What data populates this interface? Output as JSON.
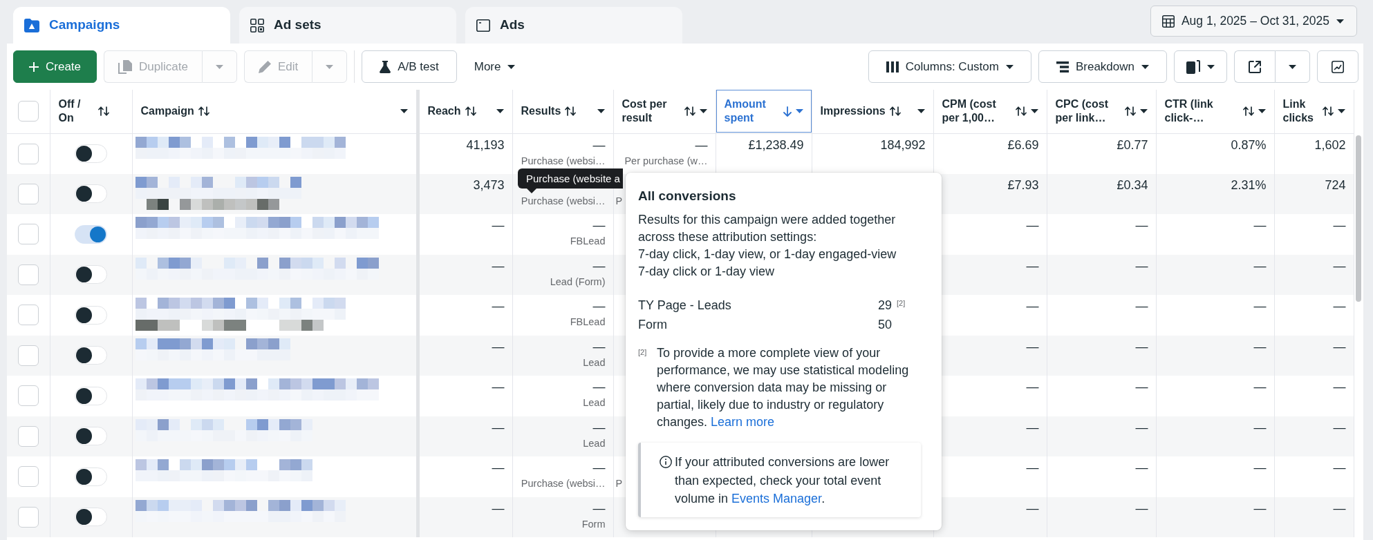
{
  "tabs": [
    {
      "kind": "campaigns",
      "label": "Campaigns",
      "selected": true
    },
    {
      "kind": "adsets",
      "label": "Ad sets",
      "selected": false
    },
    {
      "kind": "ads",
      "label": "Ads",
      "selected": false
    }
  ],
  "date_range": {
    "label": "Aug 1, 2025 – Oct 31, 2025"
  },
  "toolbar": {
    "left": [
      {
        "kind": "create",
        "label": "Create",
        "disabled": false,
        "menu": false
      },
      {
        "kind": "duplicate",
        "label": "Duplicate",
        "disabled": true,
        "menu": true,
        "split": true
      },
      {
        "kind": "edit",
        "label": "Edit",
        "disabled": true,
        "menu": true,
        "split": true
      },
      {
        "kind": "separator"
      },
      {
        "kind": "ab_test",
        "label": "A/B test",
        "disabled": false,
        "menu": false
      },
      {
        "kind": "more",
        "label": "More",
        "disabled": false,
        "menu": true,
        "split": false
      }
    ],
    "right": [
      {
        "kind": "columns",
        "label": "Columns: Custom",
        "disabled": false,
        "menu": true,
        "split": false
      },
      {
        "kind": "breakdown",
        "label": "Breakdown",
        "disabled": false,
        "menu": true,
        "split": false
      },
      {
        "kind": "reports",
        "disabled": false,
        "menu": true,
        "split": false
      },
      {
        "kind": "export",
        "disabled": false,
        "menu": true,
        "split": true
      },
      {
        "kind": "chart",
        "disabled": false,
        "menu": false
      }
    ]
  },
  "table": {
    "columns": [
      {
        "kind": "checkbox",
        "checked": false
      },
      {
        "kind": "toggle",
        "label": "Off / On",
        "sorted": false,
        "menu": false
      },
      {
        "kind": "name",
        "label": "Campaign",
        "sorted": false,
        "menu": true
      },
      {
        "kind": "metric",
        "label": "Reach",
        "sorted": false,
        "menu": true
      },
      {
        "kind": "metric",
        "label": "Results",
        "sorted": false,
        "menu": true
      },
      {
        "kind": "metric",
        "label": "Cost per result",
        "sorted": false,
        "menu": true
      },
      {
        "kind": "metric",
        "label": "Amount spent",
        "sorted": true,
        "menu": true
      },
      {
        "kind": "metric",
        "label": "Impressions",
        "sorted": false,
        "menu": true
      },
      {
        "kind": "metric",
        "label": "CPM (cost per 1,00…",
        "sorted": false,
        "menu": true
      },
      {
        "kind": "metric",
        "label": "CPC (cost per link…",
        "sorted": false,
        "menu": true
      },
      {
        "kind": "metric",
        "label": "CTR (link click-…",
        "sorted": false,
        "menu": true
      },
      {
        "kind": "metric",
        "label": "Link clicks",
        "sorted": false,
        "menu": true
      }
    ],
    "rows": [
      {
        "cells": [
          {
            "checked": false
          },
          {
            "on": false
          },
          {
            "second_line": false
          },
          {
            "value": "41,193"
          },
          {
            "value": "—",
            "note": "Purchase (websi…"
          },
          {
            "value": "—",
            "note": "Per purchase (w…",
            "covered": false
          },
          {
            "value": "£1,238.49"
          },
          {
            "value": "184,992"
          },
          {
            "value": "£6.69"
          },
          {
            "value": "£0.77"
          },
          {
            "value": "0.87%"
          },
          {
            "value": "1,602"
          }
        ]
      },
      {
        "cells": [
          {
            "checked": false
          },
          {
            "on": false
          },
          {
            "second_line": true
          },
          {
            "value": "3,473"
          },
          {
            "note": "Purchase (websi…"
          },
          {
            "note": "P",
            "covered": true
          },
          "",
          "",
          {
            "value": "£7.93"
          },
          {
            "value": "£0.34"
          },
          {
            "value": "2.31%"
          },
          {
            "value": "724"
          }
        ]
      },
      {
        "cells": [
          {
            "checked": false
          },
          {
            "on": true
          },
          {
            "second_line": false
          },
          {
            "value": "—"
          },
          {
            "value": "—",
            "note": "FBLead"
          },
          "",
          "",
          "",
          {
            "value": "—"
          },
          {
            "value": "—"
          },
          {
            "value": "—"
          },
          {
            "value": "—"
          }
        ]
      },
      {
        "cells": [
          {
            "checked": false
          },
          {
            "on": false
          },
          {
            "second_line": false
          },
          {
            "value": "—"
          },
          {
            "value": "—",
            "note": "Lead (Form)"
          },
          "",
          "",
          "",
          {
            "value": "—"
          },
          {
            "value": "—"
          },
          {
            "value": "—"
          },
          {
            "value": "—"
          }
        ]
      },
      {
        "cells": [
          {
            "checked": false
          },
          {
            "on": false
          },
          {
            "second_line": true
          },
          {
            "value": "—"
          },
          {
            "value": "—",
            "note": "FBLead"
          },
          "",
          "",
          "",
          {
            "value": "—"
          },
          {
            "value": "—"
          },
          {
            "value": "—"
          },
          {
            "value": "—"
          }
        ]
      },
      {
        "cells": [
          {
            "checked": false
          },
          {
            "on": false
          },
          {
            "second_line": false
          },
          {
            "value": "—"
          },
          {
            "value": "—",
            "note": "Lead"
          },
          "",
          "",
          "",
          {
            "value": "—"
          },
          {
            "value": "—"
          },
          {
            "value": "—"
          },
          {
            "value": "—"
          }
        ]
      },
      {
        "cells": [
          {
            "checked": false
          },
          {
            "on": false
          },
          {
            "second_line": false
          },
          {
            "value": "—"
          },
          {
            "value": "—",
            "note": "Lead"
          },
          "",
          "",
          "",
          {
            "value": "—"
          },
          {
            "value": "—"
          },
          {
            "value": "—"
          },
          {
            "value": "—"
          }
        ]
      },
      {
        "cells": [
          {
            "checked": false
          },
          {
            "on": false
          },
          {
            "second_line": false
          },
          {
            "value": "—"
          },
          {
            "value": "—",
            "note": "Lead"
          },
          "",
          "",
          "",
          {
            "value": "—"
          },
          {
            "value": "—"
          },
          {
            "value": "—"
          },
          {
            "value": "—"
          }
        ]
      },
      {
        "cells": [
          {
            "checked": false
          },
          {
            "on": false
          },
          {
            "second_line": false
          },
          {
            "value": "—"
          },
          {
            "value": "—",
            "note": "Purchase (websi…"
          },
          {
            "note": "P",
            "covered": true
          },
          "",
          "",
          {
            "value": "—"
          },
          {
            "value": "—"
          },
          {
            "value": "—"
          },
          {
            "value": "—"
          }
        ]
      },
      {
        "cells": [
          {
            "checked": false
          },
          {
            "on": false
          },
          {
            "second_line": false
          },
          {
            "value": "—"
          },
          {
            "value": "—",
            "note": "Form"
          },
          "",
          "",
          "",
          {
            "value": "—"
          },
          {
            "value": "—"
          },
          {
            "value": "—"
          },
          {
            "value": "—"
          }
        ]
      }
    ]
  },
  "results_tooltip": {
    "text": "Purchase (website a"
  },
  "attribution_popover": {
    "title": "All conversions",
    "intro": "Results for this campaign were added together across these attribution settings:",
    "settings": [
      "7-day click, 1-day view, or 1-day engaged-view",
      "7-day click or 1-day view"
    ],
    "conversions": [
      {
        "label": "TY Page - Leads",
        "value": "29",
        "note": "[2]"
      },
      {
        "label": "Form",
        "value": "50"
      }
    ],
    "footnote": {
      "mark": "[2]",
      "text": "To provide a more complete view of your performance, we may use statistical modeling where conversion data may be missing or partial, likely due to industry or regulatory changes.",
      "link": "Learn more"
    },
    "notice": {
      "text": "If your attributed conversions are lower than expected, check your total event volume in",
      "link": "Events Manager",
      "after_link": "."
    }
  }
}
